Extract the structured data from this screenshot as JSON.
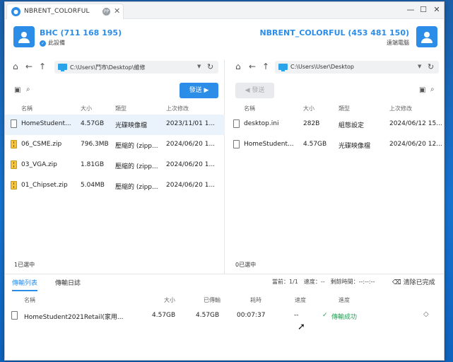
{
  "window": {
    "tab_title": "NBRENT_COLORFUL",
    "tab_badge": "PP"
  },
  "local": {
    "name": "BHC (711 168 195)",
    "status": "此設備"
  },
  "remote": {
    "name": "NBRENT_COLORFUL (453 481 150)",
    "status": "遠端電腦"
  },
  "left_pane": {
    "path": "C:\\Users\\鬥市\\Desktop\\維修",
    "send_label": "發送 ▶",
    "columns": [
      "名稱",
      "大小",
      "類型",
      "上次修改"
    ],
    "files": [
      {
        "name": "HomeStudent...",
        "size": "4.57GB",
        "type": "光碟映像檔",
        "modified": "2023/11/01 1...",
        "icon": "file-icon"
      },
      {
        "name": "06_CSME.zip",
        "size": "796.3MB",
        "type": "壓縮的 (zipp...",
        "modified": "2024/06/20 1...",
        "icon": "zip-icon"
      },
      {
        "name": "03_VGA.zip",
        "size": "1.81GB",
        "type": "壓縮的 (zipp...",
        "modified": "2024/06/20 1...",
        "icon": "zip-icon"
      },
      {
        "name": "01_Chipset.zip",
        "size": "5.04MB",
        "type": "壓縮的 (zipp...",
        "modified": "2024/06/20 1...",
        "icon": "zip-icon"
      }
    ],
    "status": "1已選中"
  },
  "right_pane": {
    "path": "C:\\Users\\User\\Desktop",
    "send_label": "◀ 發送",
    "columns": [
      "名稱",
      "大小",
      "類型",
      "上次修改"
    ],
    "files": [
      {
        "name": "desktop.ini",
        "size": "282B",
        "type": "組態設定",
        "modified": "2024/06/12 15...",
        "icon": "file-icon"
      },
      {
        "name": "HomeStudent...",
        "size": "4.57GB",
        "type": "光碟映像檔",
        "modified": "2024/06/20 12...",
        "icon": "file-icon"
      }
    ],
    "status": "0已選中"
  },
  "transfer": {
    "tabs": [
      "傳輸列表",
      "傳輸日誌"
    ],
    "stats": "當前：1/1　速度：--　剩餘時間：--:--:--",
    "clear_label": "清除已完成",
    "columns": [
      "名稱",
      "大小",
      "已傳輸",
      "耗時",
      "速度",
      "進度"
    ],
    "rows": [
      {
        "name": "HomeStudent2021Retail(家用...",
        "size": "4.57GB",
        "transferred": "4.57GB",
        "elapsed": "00:07:37",
        "speed": "--",
        "progress": "傳輸成功"
      }
    ]
  }
}
